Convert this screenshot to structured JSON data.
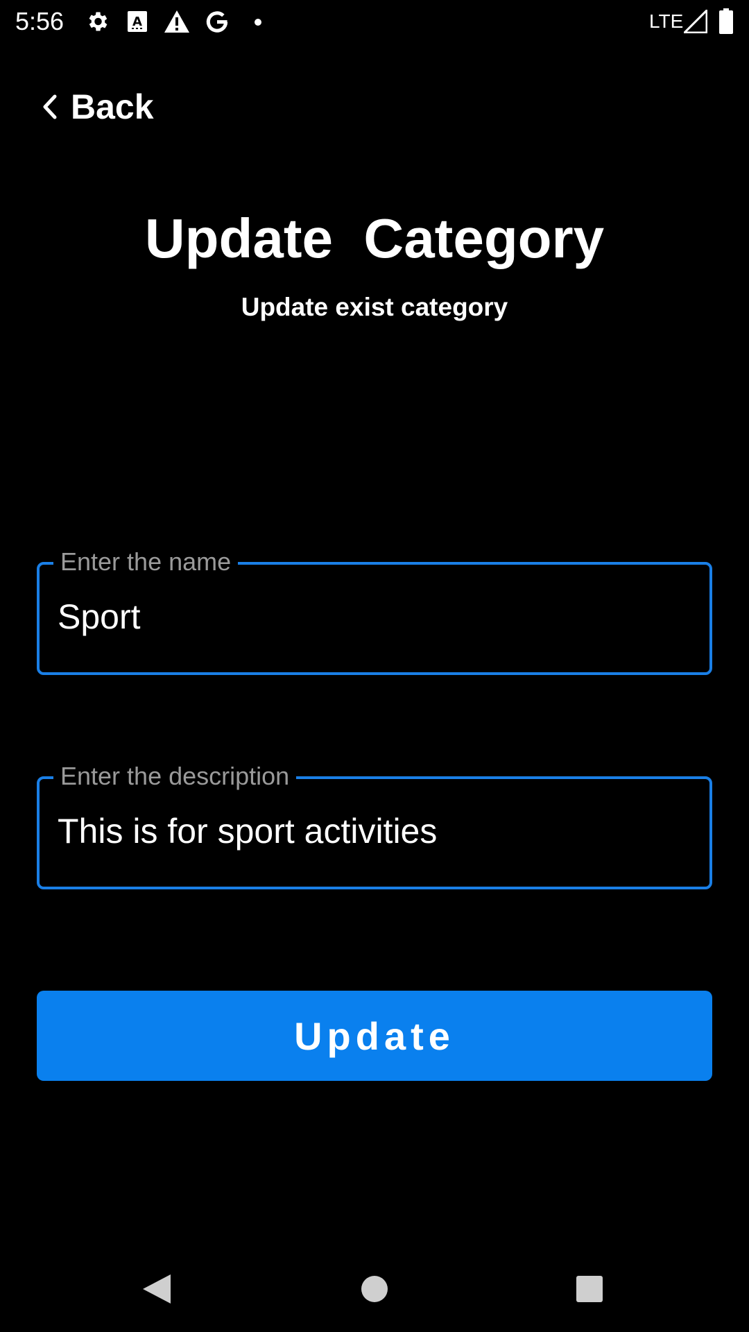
{
  "status_bar": {
    "time": "5:56",
    "network": "LTE",
    "icons": [
      "gear-icon",
      "font-a-icon",
      "warning-icon",
      "google-g-icon",
      "dot-icon",
      "signal-icon",
      "battery-icon"
    ]
  },
  "header": {
    "back_label": "Back"
  },
  "main": {
    "title": "Update  Category",
    "subtitle": "Update exist category"
  },
  "form": {
    "name_label": "Enter the name",
    "name_value": "Sport",
    "description_label": "Enter the description",
    "description_value": "This is for sport activities",
    "submit_label": "Update"
  },
  "colors": {
    "background": "#000000",
    "accent": "#0a80ee",
    "field_border": "#1a7fe6",
    "label_gray": "#9a9a9a"
  },
  "nav_bar": {
    "icons": [
      "back-triangle-icon",
      "home-circle-icon",
      "recents-square-icon"
    ]
  }
}
